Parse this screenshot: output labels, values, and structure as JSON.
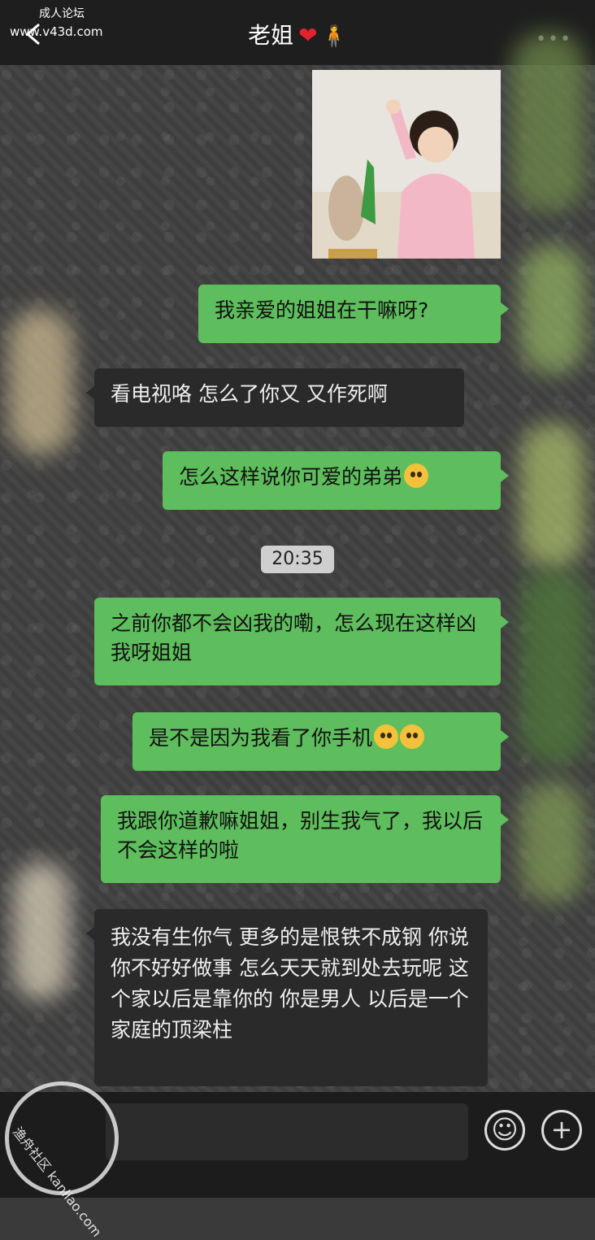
{
  "watermark_top": {
    "line1": "成人论坛",
    "line2": "www.v43d.com"
  },
  "header": {
    "title": "老姐"
  },
  "messages": [
    {
      "from": "me",
      "text": "我亲爱的姐姐在干嘛呀?"
    },
    {
      "from": "her",
      "text": "看电视咯 怎么了你又 又作死啊"
    },
    {
      "from": "me",
      "text": "怎么这样说你可爱的弟弟"
    },
    {
      "from": "me",
      "text": "之前你都不会凶我的嘞，怎么现在这样凶我呀姐姐"
    },
    {
      "from": "me",
      "text": "是不是因为我看了你手机"
    },
    {
      "from": "me",
      "text": "我跟你道歉嘛姐姐，别生我气了，我以后不会这样的啦"
    },
    {
      "from": "her",
      "text": "我没有生你气 更多的是恨铁不成钢 你说你不好好做事 怎么天天就到处去玩呢 这个家以后是靠你的 你是男人 以后是一个家庭的顶梁柱"
    }
  ],
  "timestamp": "20:35",
  "watermark_bottom": {
    "text": "渔舟社区",
    "url": "kanliao.com"
  },
  "icons": {
    "back": "chevron-left-icon",
    "more": "more-icon",
    "emoji": "smiley-icon",
    "plus": "plus-icon"
  }
}
